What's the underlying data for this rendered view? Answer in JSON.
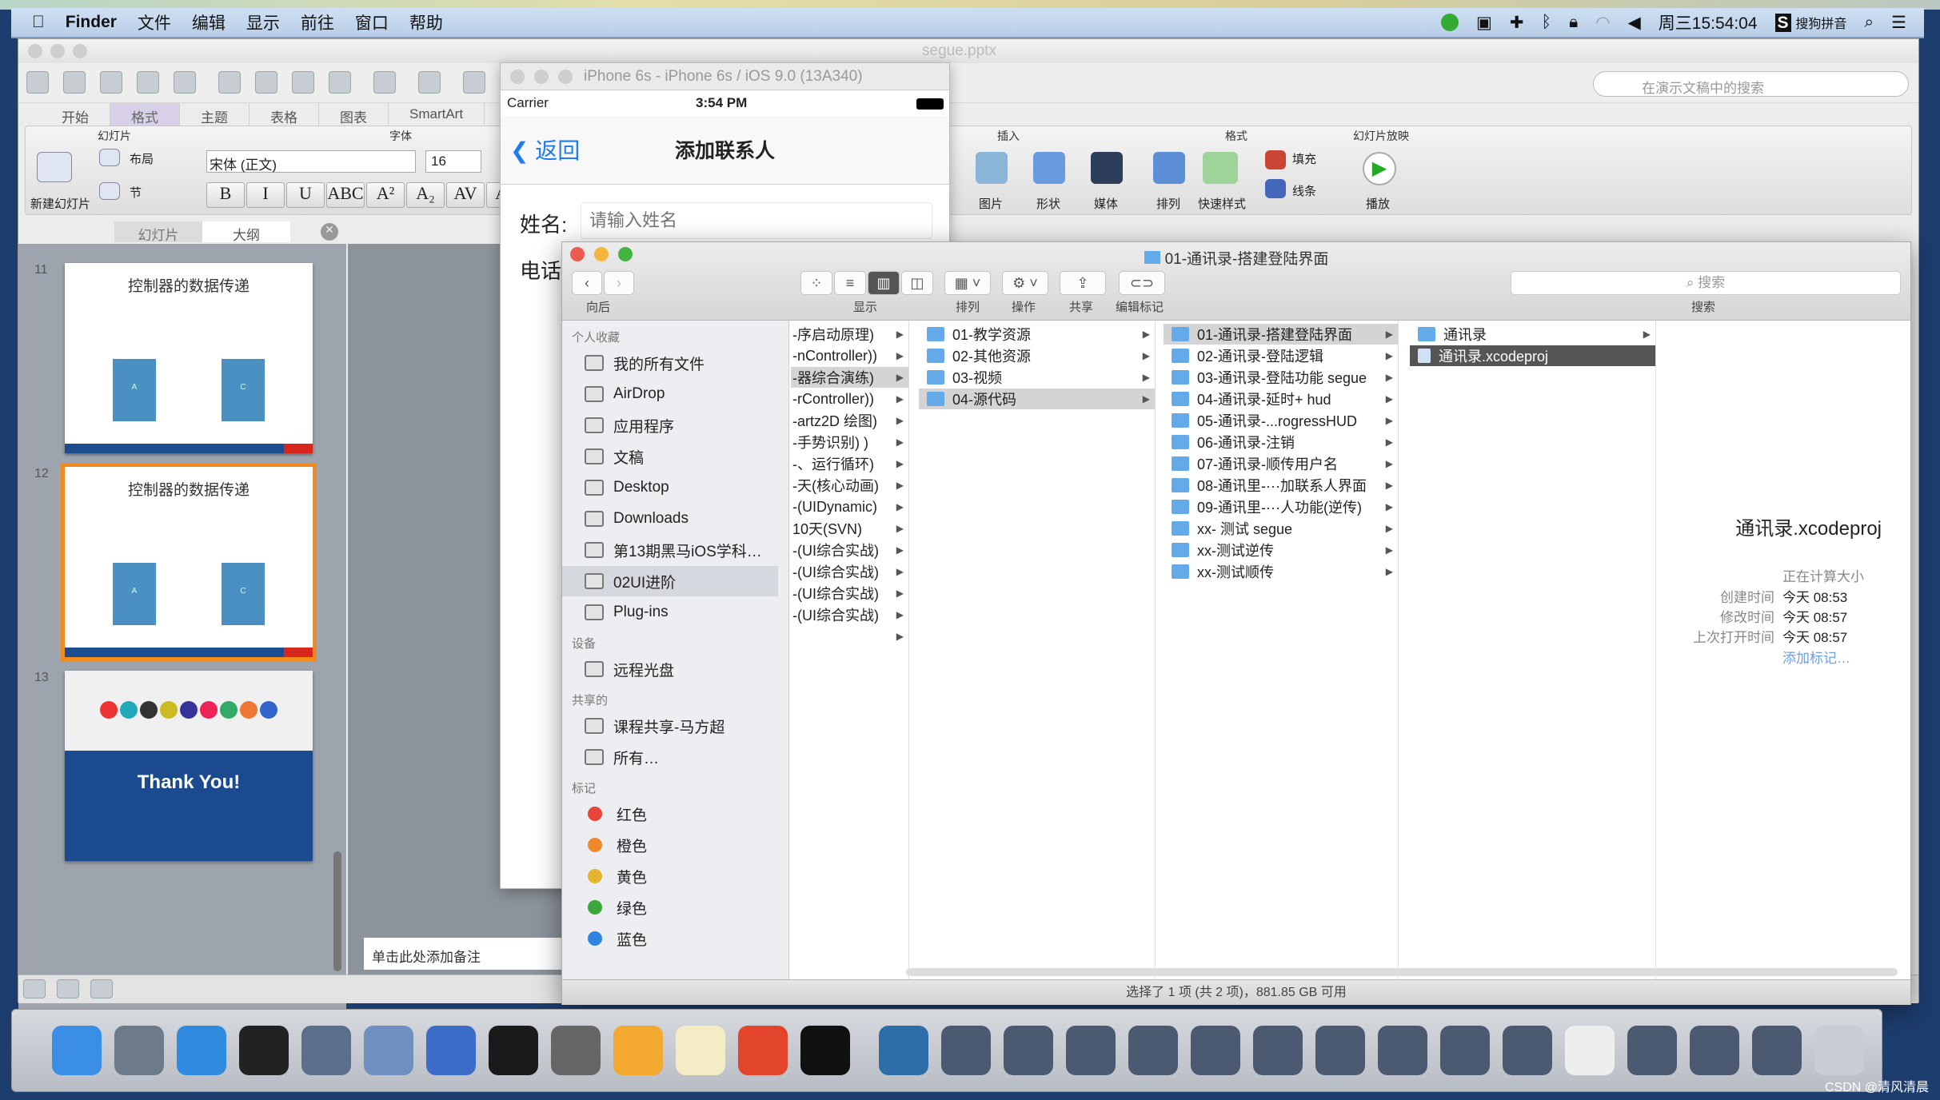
{
  "menubar": {
    "app": "Finder",
    "items": [
      "文件",
      "编辑",
      "显示",
      "前往",
      "窗口",
      "帮助"
    ],
    "clock": "周三15:54:04",
    "input_method": "搜狗拼音"
  },
  "ppt": {
    "filename": "segue.pptx",
    "search_placeholder": "在演示文稿中的搜索",
    "tabs": [
      "开始",
      "格式",
      "主题",
      "表格",
      "图表",
      "SmartArt"
    ],
    "groups": {
      "slides": "幻灯片",
      "font": "字体",
      "insert": "插入",
      "format": "格式",
      "slideshow": "幻灯片放映"
    },
    "new_slide": "新建幻灯片",
    "layout": "布局",
    "section": "节",
    "font_name": "宋体 (正文)",
    "font_size": "16",
    "fmt_buttons": [
      "B",
      "I",
      "U",
      "ABC",
      "A²",
      "A₂",
      "AV",
      "Aa"
    ],
    "insert_items": [
      "图片",
      "形状",
      "媒体"
    ],
    "format_items": [
      "排列",
      "快速样式"
    ],
    "fill": "填充",
    "line": "线条",
    "play": "播放",
    "panel_tabs": [
      "幻灯片",
      "大纲"
    ],
    "slides": [
      {
        "num": "11",
        "title": "控制器的数据传递",
        "a": "A",
        "c": "C"
      },
      {
        "num": "12",
        "title": "控制器的数据传递",
        "a": "A",
        "c": "C"
      },
      {
        "num": "13",
        "thanks": "Thank You!"
      }
    ],
    "notes_placeholder": "单击此处添加备注"
  },
  "simulator": {
    "title": "iPhone 6s - iPhone 6s / iOS 9.0 (13A340)",
    "carrier": "Carrier",
    "time": "3:54 PM",
    "back": "返回",
    "nav_title": "添加联系人",
    "name_label": "姓名:",
    "name_placeholder": "请输入姓名",
    "phone_label": "电话"
  },
  "finder": {
    "title": "01-通讯录-搭建登陆界面",
    "toolbar": {
      "back": "向后",
      "view": "显示",
      "arrange": "排列",
      "action": "操作",
      "share": "共享",
      "tags": "编辑标记",
      "search": "搜索",
      "search_placeholder": "搜索"
    },
    "sidebar": [
      {
        "section": "个人收藏",
        "items": [
          "我的所有文件",
          "AirDrop",
          "应用程序",
          "文稿",
          "Desktop",
          "Downloads",
          "第13期黑马iOS学科…",
          "02UI进阶",
          "Plug-ins"
        ],
        "selected": 7
      },
      {
        "section": "设备",
        "items": [
          "远程光盘"
        ]
      },
      {
        "section": "共享的",
        "items": [
          "课程共享-马方超",
          "所有…"
        ]
      },
      {
        "section": "标记",
        "items": [
          "红色",
          "橙色",
          "黄色",
          "绿色",
          "蓝色"
        ],
        "colors": [
          "#e8443a",
          "#ef8a2a",
          "#e4b42c",
          "#3aa63c",
          "#2f86e0"
        ]
      }
    ],
    "columns": [
      {
        "items": [
          "-序启动原理)",
          "-nController))",
          "-器综合演练)",
          "-rController))",
          "-artz2D 绘图)",
          "-手势识别) )",
          "-、运行循环)",
          "-天(核心动画)",
          "-(UIDynamic)",
          "10天(SVN)",
          "-(UI综合实战)",
          "-(UI综合实战)",
          "-(UI综合实战)",
          "-(UI综合实战)",
          ""
        ],
        "selected": 2
      },
      {
        "items": [
          "01-教学资源",
          "02-其他资源",
          "03-视频",
          "04-源代码"
        ],
        "selected": 3
      },
      {
        "items": [
          "01-通讯录-搭建登陆界面",
          "02-通讯录-登陆逻辑",
          "03-通讯录-登陆功能 segue",
          "04-通讯录-延时+ hud",
          "05-通讯录-...rogressHUD",
          "06-通讯录-注销",
          "07-通讯录-顺传用户名",
          "08-通讯里-···加联系人界面",
          "09-通讯里-···人功能(逆传)",
          "xx- 测试 segue",
          "xx-测试逆传",
          "xx-测试顺传"
        ],
        "selected": 0
      },
      {
        "items": [
          "通讯录",
          "通讯录.xcodeproj"
        ],
        "selected": 1
      }
    ],
    "preview": {
      "name": "通讯录.xcodeproj",
      "size": "正在计算大小",
      "rows": [
        [
          "创建时间",
          "今天 08:53"
        ],
        [
          "修改时间",
          "今天 08:57"
        ],
        [
          "上次打开时间",
          "今天 08:57"
        ]
      ],
      "add_tag": "添加标记…"
    },
    "status": "选择了 1 项 (共 2 项)，881.85 GB 可用"
  },
  "dock_colors": [
    "#3a8ee6",
    "#6c7a8a",
    "#2f8be0",
    "#222",
    "#5a6f8c",
    "#6e8fbf",
    "#3b6cc7",
    "#1a1a1a",
    "#666",
    "#f3a830",
    "#f4ecc4",
    "#e2452c",
    "#111",
    "#2d6ea8",
    "#4b5a70",
    "#4b5a70",
    "#4b5a70",
    "#4b5a70",
    "#4b5a70",
    "#4b5a70",
    "#4b5a70",
    "#4b5a70",
    "#4b5a70",
    "#4b5a70",
    "#eee",
    "#4b5a70",
    "#4b5a70",
    "#4b5a70",
    "#c9cdd3"
  ],
  "watermark": "CSDN @清风清晨"
}
